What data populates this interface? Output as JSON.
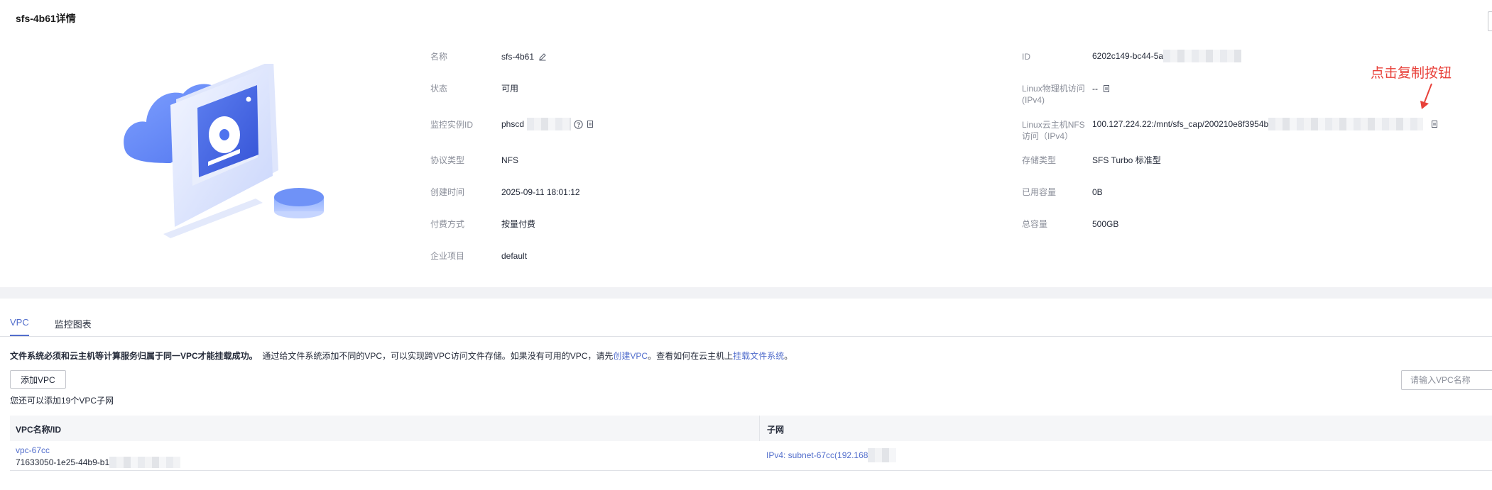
{
  "header": {
    "title": "sfs-4b61详情"
  },
  "left_info": [
    {
      "label": "名称",
      "value": "sfs-4b61"
    },
    {
      "label": "状态",
      "value": "可用"
    },
    {
      "label": "监控实例ID",
      "value": "phscd"
    },
    {
      "label": "协议类型",
      "value": "NFS"
    },
    {
      "label": "创建时间",
      "value": "2025-09-11 18:01:12"
    },
    {
      "label": "付费方式",
      "value": "按量付费"
    },
    {
      "label": "企业项目",
      "value": "default"
    }
  ],
  "right_info": [
    {
      "label": "ID",
      "value": "6202c149-bc44-5a"
    },
    {
      "label": "Linux物理机访问(IPv4)",
      "value": "--"
    },
    {
      "label": "Linux云主机NFS访问（IPv4）",
      "value": "100.127.224.22:/mnt/sfs_cap/200210e8f3954b"
    },
    {
      "label": "存储类型",
      "value": "SFS Turbo 标准型"
    },
    {
      "label": "已用容量",
      "value": "0B"
    },
    {
      "label": "总容量",
      "value": "500GB"
    }
  ],
  "annotation": "点击复制按钮",
  "tabs": [
    {
      "label": "VPC",
      "active": true
    },
    {
      "label": "监控图表",
      "active": false
    }
  ],
  "notice": {
    "bold": "文件系统必须和云主机等计算服务归属于同一VPC才能挂载成功。",
    "text1": "通过给文件系统添加不同的VPC，可以实现跨VPC访问文件存储。如果没有可用的VPC，请先",
    "link1": "创建VPC",
    "text2": "。查看如何在云主机上",
    "link2": "挂载文件系统",
    "text3": "。"
  },
  "toolbar": {
    "add_vpc": "添加VPC",
    "search_placeholder": "请输入VPC名称",
    "hint": "您还可以添加19个VPC子网"
  },
  "table": {
    "headers": [
      "VPC名称/ID",
      "子网"
    ],
    "rows": [
      {
        "vpc_name": "vpc-67cc",
        "vpc_id": "71633050-1e25-44b9-b1",
        "subnet": "IPv4: subnet-67cc(192.168"
      }
    ]
  },
  "colors": {
    "accent": "#526ecc",
    "annotation": "#e8413a",
    "label": "#8a8e99"
  }
}
